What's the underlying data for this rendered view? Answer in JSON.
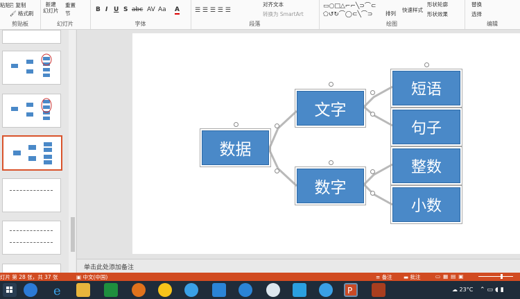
{
  "ribbon": {
    "groups": {
      "clipboard": "剪贴板",
      "slides": "幻灯片",
      "font": "字体",
      "paragraph": "段落",
      "drawing": "绘图",
      "editing": "编辑"
    },
    "paste": "粘贴",
    "copy": "复制",
    "format_painter": "格式刷",
    "new_slide": "新建\n幻灯片",
    "reset": "重置",
    "section": "节",
    "align_text": "对齐文本",
    "convert_smartart": "转换为 SmartArt",
    "arrange": "排列",
    "quick_styles": "快速样式",
    "shape_outline": "形状轮廓",
    "shape_effects": "形状效果",
    "replace": "替换",
    "select": "选择",
    "bold": "B",
    "italic": "I",
    "underline": "U",
    "shadow": "S",
    "strike": "abc",
    "spacing": "AV",
    "case": "Aa",
    "font_color": "A"
  },
  "slide": {
    "root": "数据",
    "mid_top": "文字",
    "mid_bottom": "数字",
    "leaves": [
      "短语",
      "句子",
      "整数",
      "小数"
    ]
  },
  "notes_placeholder": "单击此处添加备注",
  "status": {
    "slide_info": "灯片 第 28 张，共 37 张",
    "language": "中文(中国)",
    "notes": "备注",
    "comments": "批注"
  },
  "taskbar": {
    "weather": "23°C"
  },
  "colors": {
    "accent": "#d14b21",
    "box_fill": "#4a89c8",
    "box_border": "#2e6aa6"
  }
}
